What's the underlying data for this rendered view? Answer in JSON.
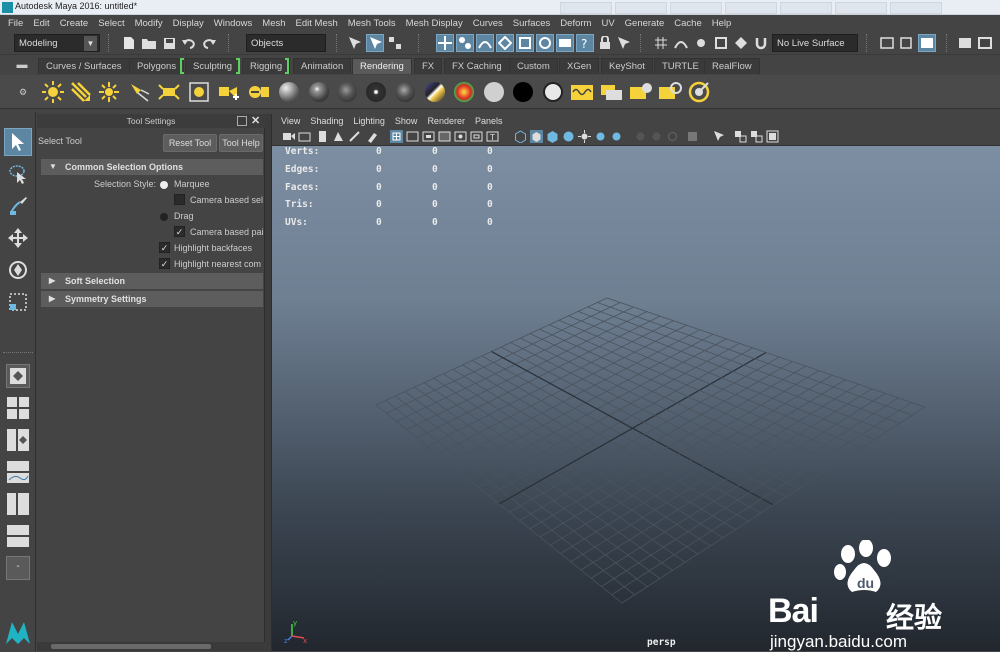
{
  "window": {
    "title": "Autodesk Maya 2016: untitled*"
  },
  "menubar": [
    "File",
    "Edit",
    "Create",
    "Select",
    "Modify",
    "Display",
    "Windows",
    "Mesh",
    "Edit Mesh",
    "Mesh Tools",
    "Mesh Display",
    "Curves",
    "Surfaces",
    "Deform",
    "UV",
    "Generate",
    "Cache",
    "Help"
  ],
  "statusline": {
    "menuset": "Modeling",
    "selection_mode": "Objects",
    "live_surface": "No Live Surface"
  },
  "shelf_tabs": [
    "Curves / Surfaces",
    "Polygons",
    "Sculpting",
    "Rigging",
    "Animation",
    "Rendering",
    "FX",
    "FX Caching",
    "Custom",
    "XGen",
    "KeyShot",
    "TURTLE",
    "RealFlow"
  ],
  "active_shelf_tab": "Rendering",
  "tool_settings": {
    "panel_title": "Tool Settings",
    "tool_name": "Select Tool",
    "reset_button": "Reset Tool",
    "help_button": "Tool Help",
    "common_section": "Common Selection Options",
    "selection_style_label": "Selection Style:",
    "marquee": "Marquee",
    "camera_based_sel": "Camera based sel",
    "drag": "Drag",
    "camera_based_paint": "Camera based pai",
    "highlight_backfaces": "Highlight backfaces",
    "highlight_nearest": "Highlight nearest com",
    "soft_selection": "Soft Selection",
    "symmetry_settings": "Symmetry Settings"
  },
  "viewport": {
    "menu": [
      "View",
      "Shading",
      "Lighting",
      "Show",
      "Renderer",
      "Panels"
    ],
    "hud": [
      {
        "label": "Verts:",
        "a": "0",
        "b": "0",
        "c": "0"
      },
      {
        "label": "Edges:",
        "a": "0",
        "b": "0",
        "c": "0"
      },
      {
        "label": "Faces:",
        "a": "0",
        "b": "0",
        "c": "0"
      },
      {
        "label": "Tris:",
        "a": "0",
        "b": "0",
        "c": "0"
      },
      {
        "label": "UVs:",
        "a": "0",
        "b": "0",
        "c": "0"
      }
    ],
    "camera": "persp"
  },
  "watermark": {
    "brand": "Bai",
    "brand_cn": "经验",
    "url": "jingyan.baidu.com"
  },
  "colors": {
    "accent": "#5d86a3",
    "bracket": "#5fcf5f",
    "bg": "#444444"
  }
}
